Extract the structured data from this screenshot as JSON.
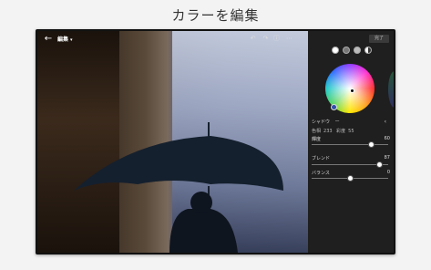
{
  "headline": "カラーを編集",
  "toolbar": {
    "mode_label": "編集",
    "mode_caret": "▾",
    "back_glyph": "←",
    "done_label": "完了"
  },
  "panel": {
    "section_title": "シャドウ",
    "section_value": "ー",
    "hue_label": "色相",
    "hue_value": "233",
    "sat_label": "彩度",
    "sat_value": "55",
    "luminance_label": "輝度",
    "luminance_value": "60",
    "blend_label": "ブレンド",
    "blend_value": "87",
    "balance_label": "バランス",
    "balance_value": "0"
  },
  "levels": {
    "luminance_fraction": 0.8,
    "blend_fraction": 0.92,
    "balance_fraction": 0.5
  },
  "colors": {
    "panel_bg": "#1f1f1f",
    "accent": "#2f4fa8"
  }
}
